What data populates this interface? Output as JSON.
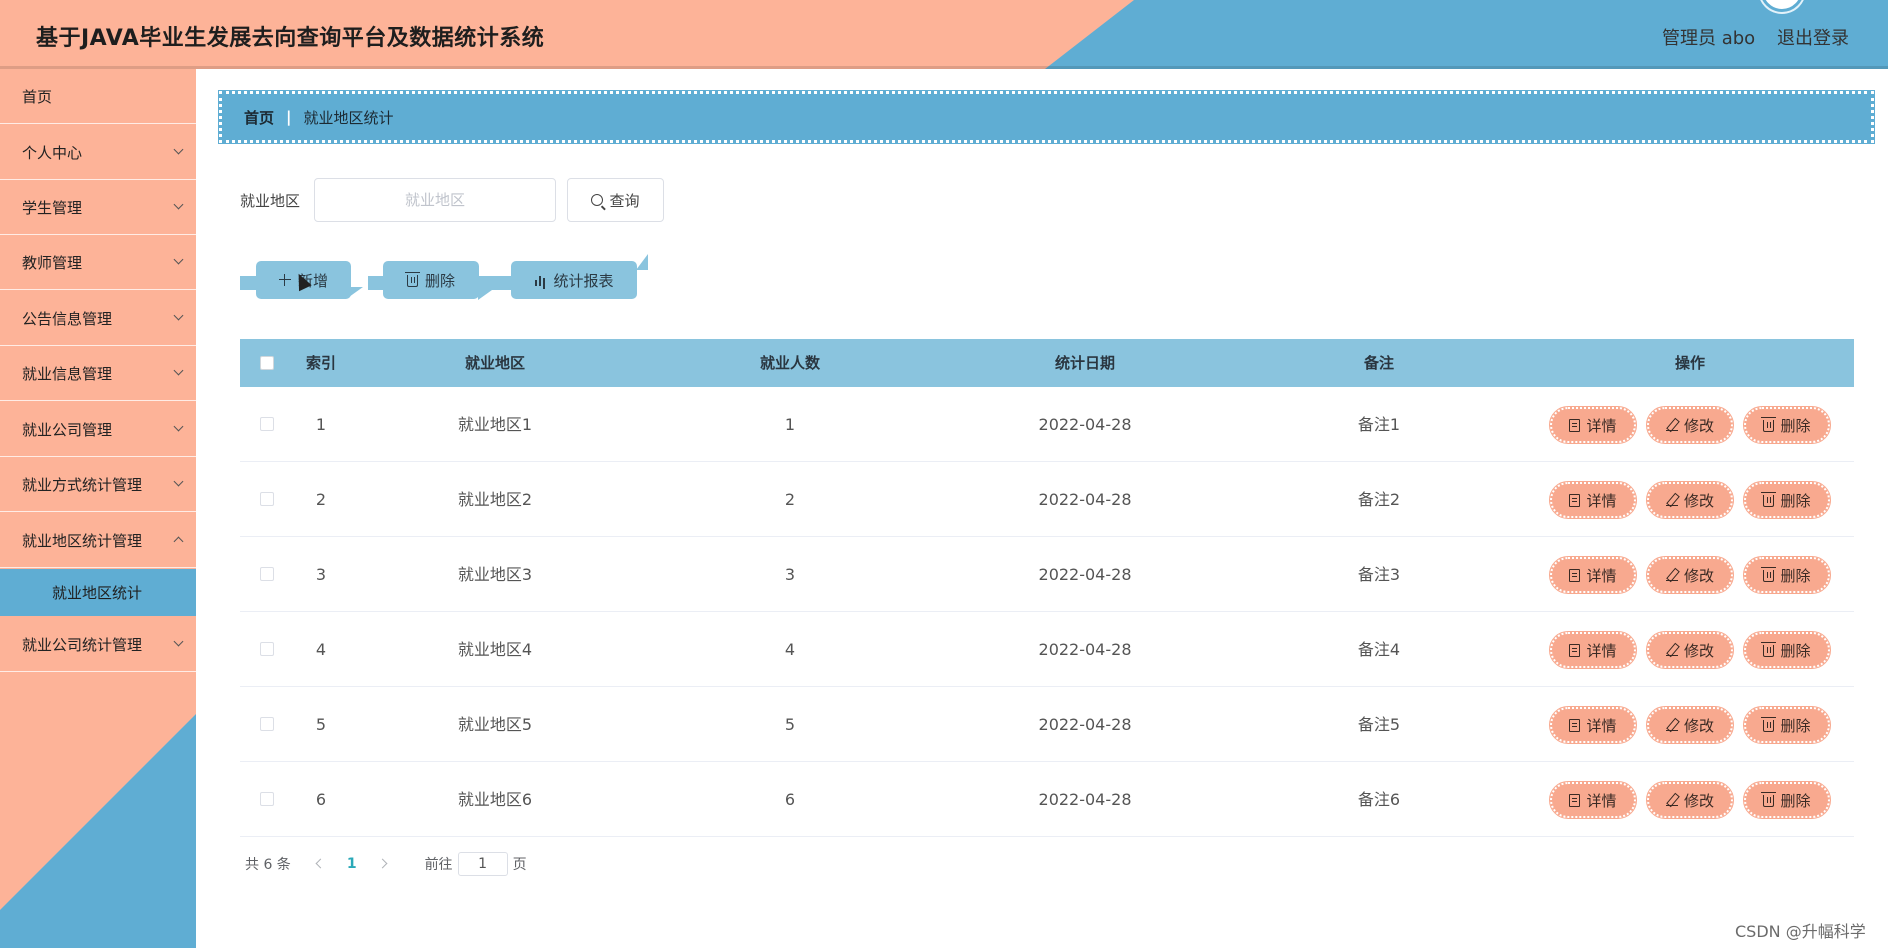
{
  "header": {
    "title": "基于JAVA毕业生发展去向查询平台及数据统计系统",
    "user_label": "管理员 abo",
    "logout_label": "退出登录"
  },
  "sidebar": {
    "items": [
      {
        "label": "首页",
        "has_children": false
      },
      {
        "label": "个人中心",
        "has_children": true
      },
      {
        "label": "学生管理",
        "has_children": true
      },
      {
        "label": "教师管理",
        "has_children": true
      },
      {
        "label": "公告信息管理",
        "has_children": true
      },
      {
        "label": "就业信息管理",
        "has_children": true
      },
      {
        "label": "就业公司管理",
        "has_children": true
      },
      {
        "label": "就业方式统计管理",
        "has_children": true
      },
      {
        "label": "就业地区统计管理",
        "has_children": true
      },
      {
        "label": "就业公司统计管理",
        "has_children": true
      }
    ],
    "active_subitem": "就业地区统计"
  },
  "breadcrumb": {
    "home": "首页",
    "separator": "|",
    "current": "就业地区统计"
  },
  "search": {
    "label": "就业地区",
    "placeholder": "就业地区",
    "value": "",
    "button_label": "查询"
  },
  "actions": {
    "add_label": "新增",
    "delete_label": "删除",
    "report_label": "统计报表"
  },
  "table": {
    "columns": [
      "索引",
      "就业地区",
      "就业人数",
      "统计日期",
      "备注",
      "操作"
    ],
    "rows": [
      {
        "index": "1",
        "region": "就业地区1",
        "count": "1",
        "date": "2022-04-28",
        "note": "备注1"
      },
      {
        "index": "2",
        "region": "就业地区2",
        "count": "2",
        "date": "2022-04-28",
        "note": "备注2"
      },
      {
        "index": "3",
        "region": "就业地区3",
        "count": "3",
        "date": "2022-04-28",
        "note": "备注3"
      },
      {
        "index": "4",
        "region": "就业地区4",
        "count": "4",
        "date": "2022-04-28",
        "note": "备注4"
      },
      {
        "index": "5",
        "region": "就业地区5",
        "count": "5",
        "date": "2022-04-28",
        "note": "备注5"
      },
      {
        "index": "6",
        "region": "就业地区6",
        "count": "6",
        "date": "2022-04-28",
        "note": "备注6"
      }
    ],
    "row_actions": {
      "detail": "详情",
      "edit": "修改",
      "delete": "删除"
    }
  },
  "pagination": {
    "total_text": "共 6 条",
    "current_page": "1",
    "goto_label": "前往",
    "goto_value": "1",
    "page_suffix": "页"
  },
  "watermark": "CSDN @升幅科学",
  "colors": {
    "peach": "#fdb398",
    "blue": "#5fadd3",
    "light_blue": "#8ac4de",
    "salmon": "#f8a98f"
  }
}
